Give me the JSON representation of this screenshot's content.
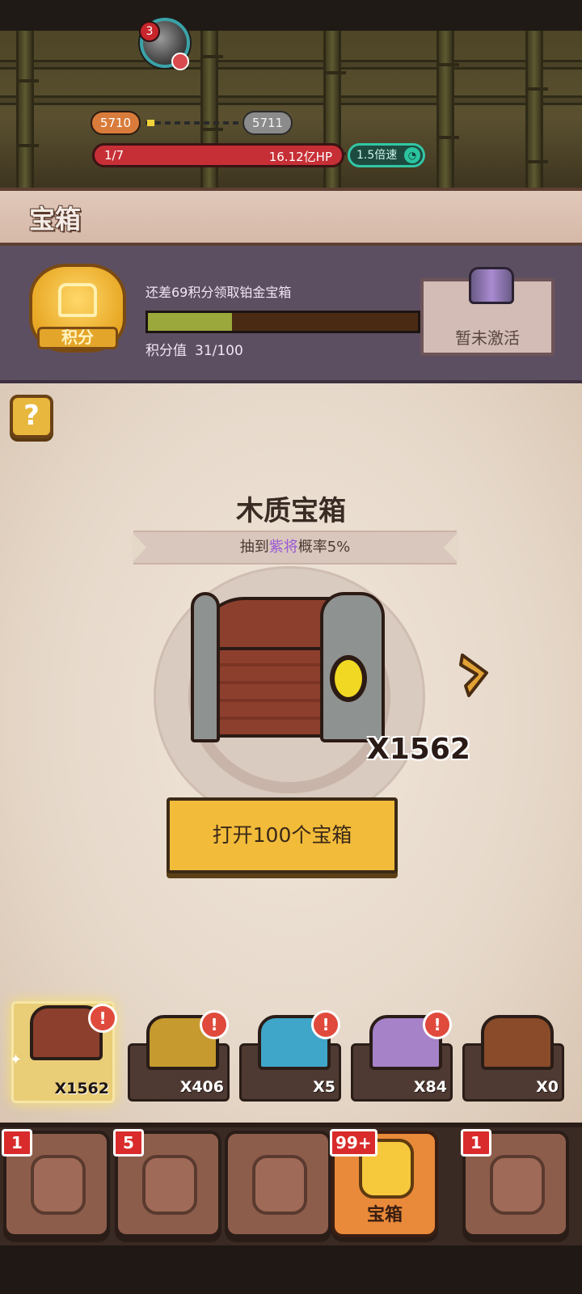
{
  "battle": {
    "avatar_badge": "3",
    "stage_current": "5710",
    "stage_next": "5711",
    "wave": "1/7",
    "boss_hp": "16.12亿HP",
    "speed": "1.5倍速"
  },
  "header": {
    "title": "宝箱"
  },
  "points": {
    "badge_label": "积分",
    "hint": "还差69积分领取铂金宝箱",
    "label": "积分值",
    "value": "31/100",
    "progress": 0.31,
    "reward_status": "暂未激活"
  },
  "main": {
    "help_label": "?",
    "chest_name": "木质宝箱",
    "prob_prefix": "抽到",
    "prob_highlight": "紫将",
    "prob_suffix": "概率5%",
    "chest_count": "X1562",
    "open_button": "打开100个宝箱"
  },
  "chest_slots": [
    {
      "count": "X1562",
      "color": "#8d3f2d",
      "selected": true,
      "alert": "!"
    },
    {
      "count": "X406",
      "color": "#c69a2e",
      "selected": false,
      "alert": "!"
    },
    {
      "count": "X5",
      "color": "#3fa6c9",
      "selected": false,
      "alert": "!"
    },
    {
      "count": "X84",
      "color": "#a682c8",
      "selected": false,
      "alert": "!"
    },
    {
      "count": "X0",
      "color": "#8a4b2a",
      "selected": false,
      "alert": ""
    }
  ],
  "nav": [
    {
      "label": "",
      "badge": "1",
      "icon": "hero-helmet-icon",
      "active": false
    },
    {
      "label": "",
      "badge": "5",
      "icon": "armor-icon",
      "active": false
    },
    {
      "label": "",
      "badge": "",
      "icon": "battle-icon",
      "active": false
    },
    {
      "label": "宝箱",
      "badge": "99+",
      "icon": "treasure-chest-icon",
      "active": true
    },
    {
      "label": "",
      "badge": "1",
      "icon": "scroll-map-icon",
      "active": false
    }
  ]
}
